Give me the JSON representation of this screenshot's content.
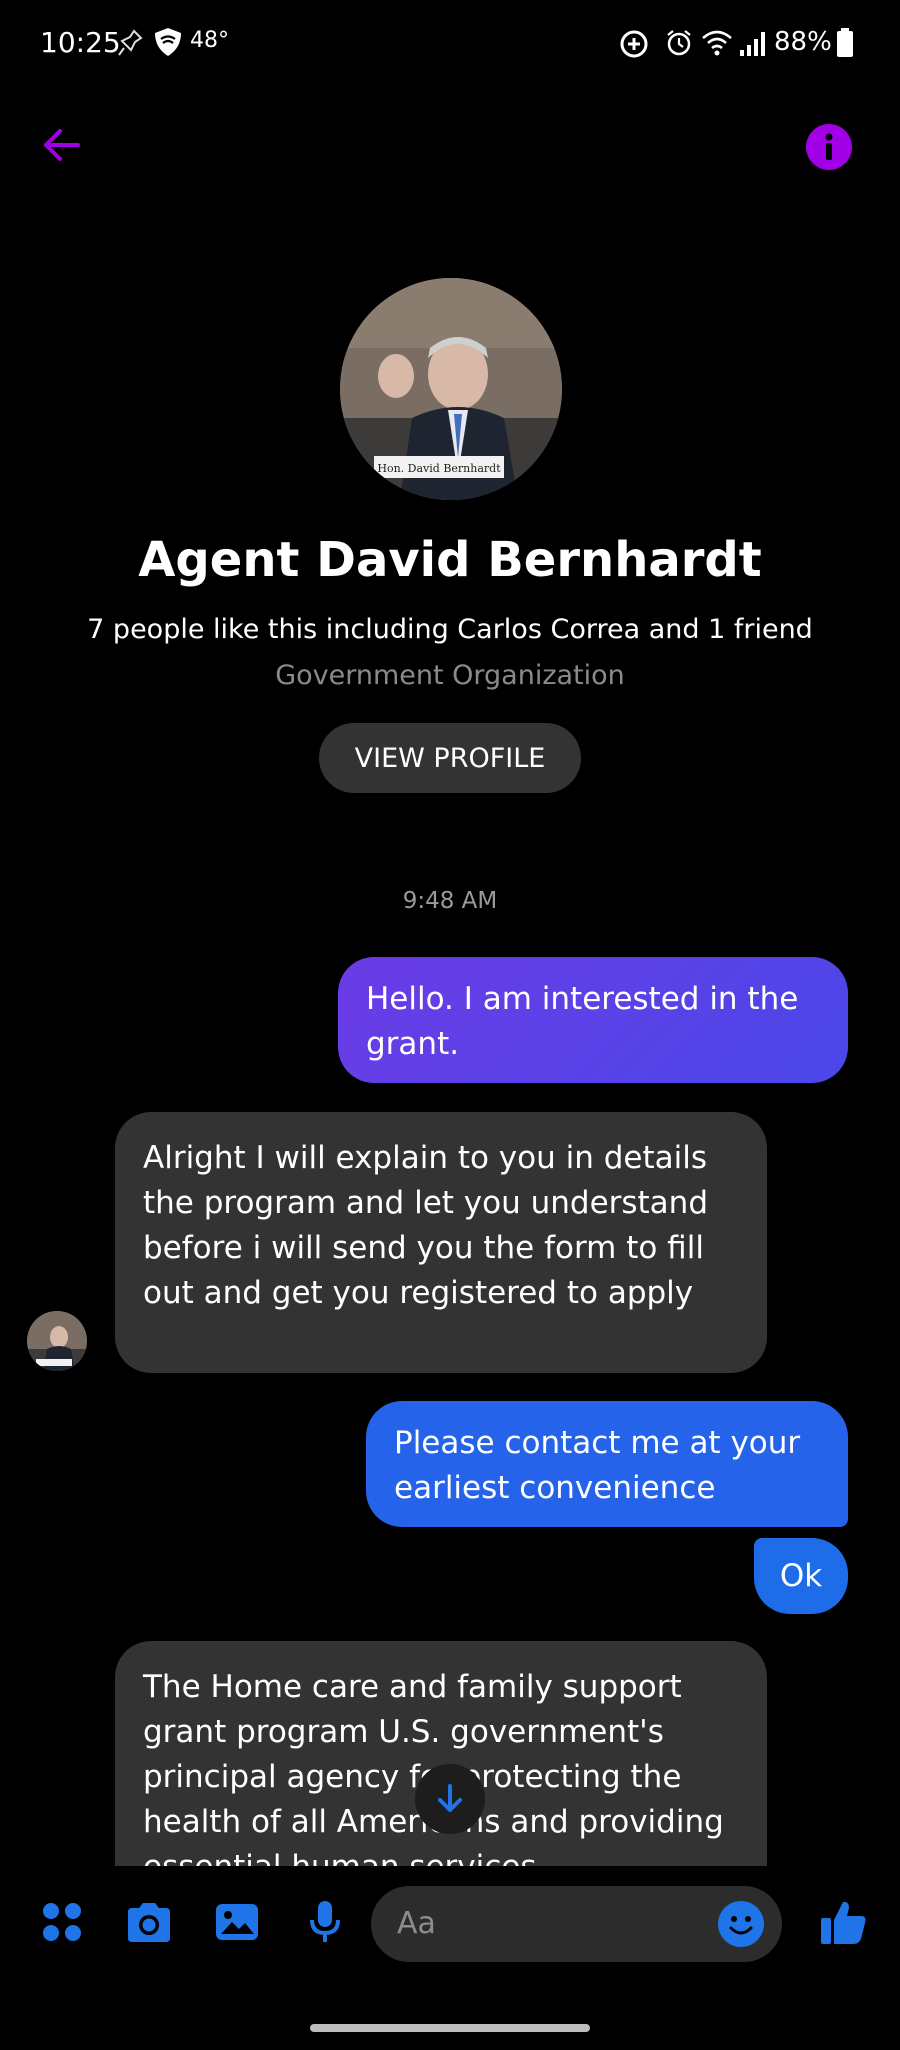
{
  "status_bar": {
    "time": "10:25",
    "temperature": "48°",
    "battery": "88%"
  },
  "header": {
    "back_icon": "arrow-left-icon",
    "info_icon": "info-icon",
    "accent_color": "#a100e6"
  },
  "profile": {
    "name": "Agent David Bernhardt",
    "likes": "7 people like this including Carlos Correa and 1 friend",
    "category": "Government Organization",
    "view_profile_label": "VIEW PROFILE",
    "photo_nameplate": "Hon. David Bernhardt"
  },
  "conversation": {
    "timestamp": "9:48 AM",
    "messages": [
      {
        "direction": "outgoing",
        "text": "Hello. I am interested in the grant."
      },
      {
        "direction": "incoming",
        "text": "Alright I will explain to you in details the program and let you understand before i will send you the form to fill out and get you registered to apply"
      },
      {
        "direction": "outgoing",
        "text": "Please contact me at your earliest convenience"
      },
      {
        "direction": "outgoing",
        "text": "Ok"
      },
      {
        "direction": "incoming",
        "text": "The Home care and family support grant program U.S. government's principal agency for protecting the health of all Americans and providing essential human services"
      }
    ]
  },
  "composer": {
    "placeholder": "Aa",
    "tools": [
      "apps-icon",
      "camera-icon",
      "image-icon",
      "microphone-icon"
    ],
    "emoji_icon": "emoji-icon",
    "like_icon": "thumbs-up-icon",
    "accent_color": "#1f74e8"
  }
}
